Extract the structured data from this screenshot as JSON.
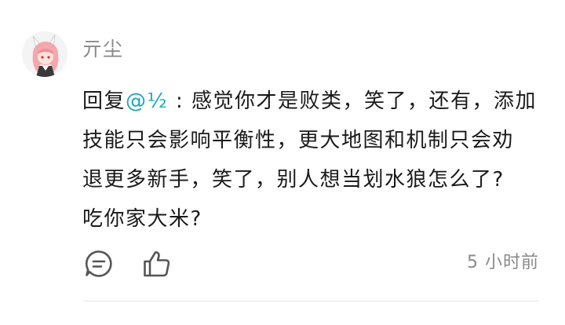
{
  "comment": {
    "username": "亓尘",
    "reply_prefix": "回复",
    "mention": "@½",
    "reply_separator": " : ",
    "lines": [
      "感觉你才是败类，笑了，还有，添加",
      "技能只会影响平衡性，更大地图和机制只会劝",
      "退更多新手，笑了，别人想当划水狼怎么了?",
      "吃你家大米?"
    ],
    "timestamp": "5 小时前"
  },
  "icons": {
    "avatar": "anime-avatar",
    "reply": "comment-bubble-icon",
    "like": "thumbs-up-icon"
  },
  "colors": {
    "mention": "#1aa7b8",
    "text": "#1a1a1a",
    "muted": "#8a8a8a",
    "divider": "#e6e6e6"
  }
}
